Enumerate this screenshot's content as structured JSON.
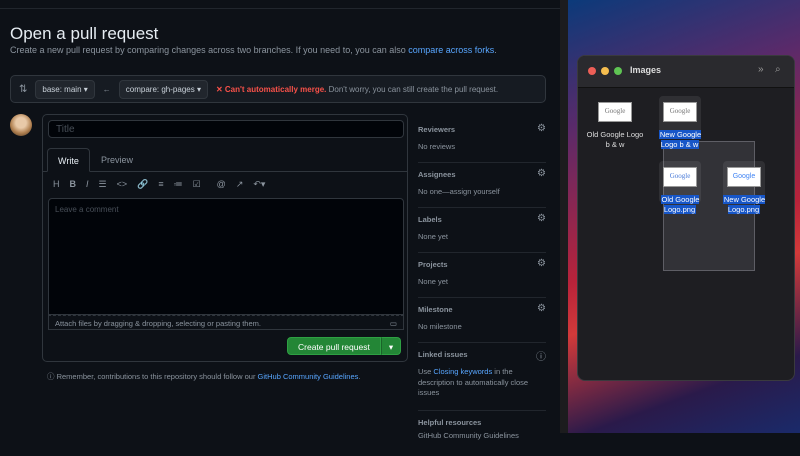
{
  "page": {
    "title": "Open a pull request",
    "subtitle": "Create a new pull request by comparing changes across two branches. If you need to, you can also ",
    "subtitle_link": "compare across forks",
    "subtitle_end": "."
  },
  "compare": {
    "base": "base: main",
    "compare": "compare: gh-pages",
    "error": "✕ Can't automatically merge.",
    "message": "Don't worry, you can still create the pull request."
  },
  "form": {
    "title_placeholder": "Title",
    "tab_write": "Write",
    "tab_preview": "Preview",
    "comment_placeholder": "Leave a comment",
    "attach": "Attach files by dragging & dropping, selecting or pasting them.",
    "create": "Create pull request",
    "note": "Remember, contributions to this repository should follow our ",
    "note_link": "GitHub Community Guidelines",
    "note_end": "."
  },
  "toolbar": [
    "H",
    "B",
    "I",
    "☰",
    "<>",
    "🔗",
    "≡",
    "≔",
    "☑",
    "@",
    "↗",
    "↶▾"
  ],
  "sidebar": [
    {
      "title": "Reviewers",
      "value": "No reviews"
    },
    {
      "title": "Assignees",
      "value": "No one—assign yourself"
    },
    {
      "title": "Labels",
      "value": "None yet"
    },
    {
      "title": "Projects",
      "value": "None yet"
    },
    {
      "title": "Milestone",
      "value": "No milestone"
    }
  ],
  "linked": {
    "title": "Linked issues",
    "pre": "Use ",
    "link": "Closing keywords",
    "post": " in the description to automatically close issues"
  },
  "helpful": {
    "title": "Helpful resources",
    "link": "GitHub Community Guidelines"
  },
  "finder": {
    "title": "Images",
    "items": [
      {
        "name": "Old Google Logo b & w",
        "thumb": "Google"
      },
      {
        "name": "New Google Logo b & w",
        "thumb": "Google"
      },
      {
        "name": "Old Google Logo.png",
        "thumb": "Google"
      },
      {
        "name": "New Google Logo.png",
        "thumb": "Google"
      }
    ]
  }
}
